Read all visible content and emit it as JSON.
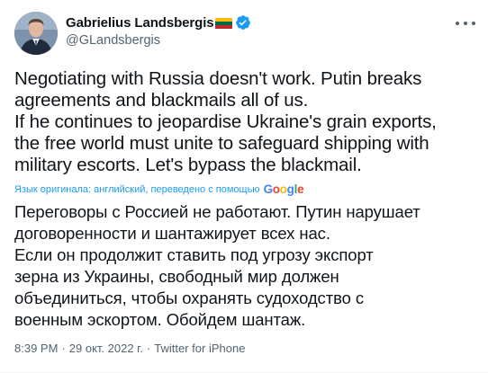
{
  "author": {
    "display_name": "Gabrielius Landsbergis",
    "handle": "@GLandsbergis",
    "flag_icon": "lithuania-flag-icon",
    "verified_icon": "verified-badge-icon",
    "verified_color": "#1d9bf0"
  },
  "tweet": {
    "lines": [
      "Negotiating with Russia doesn't work. Putin breaks",
      "agreements and blackmails all of us.",
      "If he continues to jeopardise Ukraine's grain exports,",
      "the free world must unite to safeguard shipping with",
      "military escorts. Let's bypass the blackmail."
    ]
  },
  "translation": {
    "notice": "Язык оригинала: английский, переведено с помощью",
    "provider": "Google",
    "lines": [
      "Переговоры с Россией не работают. Путин нарушает",
      "договоренности и шантажирует всех нас.",
      "Если он продолжит ставить под угрозу экспорт",
      "зерна из Украины, свободный мир должен",
      "объединиться, чтобы охранять судоходство с",
      "военным эскортом. Обойдем шантаж."
    ]
  },
  "meta": {
    "time": "8:39 PM",
    "separator": "·",
    "date": "29 окт. 2022 г.",
    "source": "Twitter for iPhone"
  }
}
